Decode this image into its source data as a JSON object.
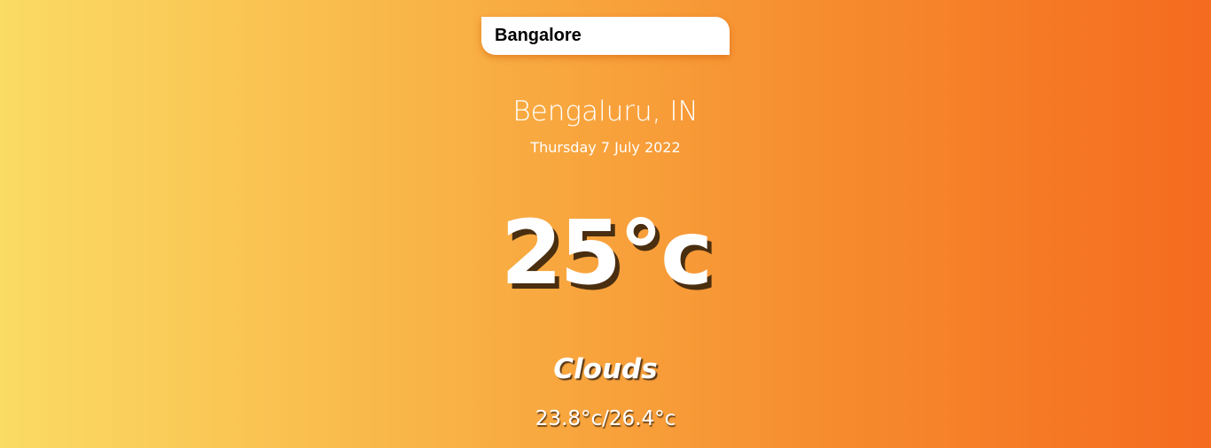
{
  "search": {
    "value": "Bangalore"
  },
  "location": {
    "name": "Bengaluru, IN",
    "date": "Thursday 7 July 2022"
  },
  "current": {
    "temperature": "25°c",
    "condition": "Clouds",
    "hi_low": "23.8°c/26.4°c"
  },
  "colors": {
    "gradient_start": "#fadb64",
    "gradient_end": "#f56b1f",
    "text": "#ffffff",
    "shadow": "#4a2e10"
  }
}
